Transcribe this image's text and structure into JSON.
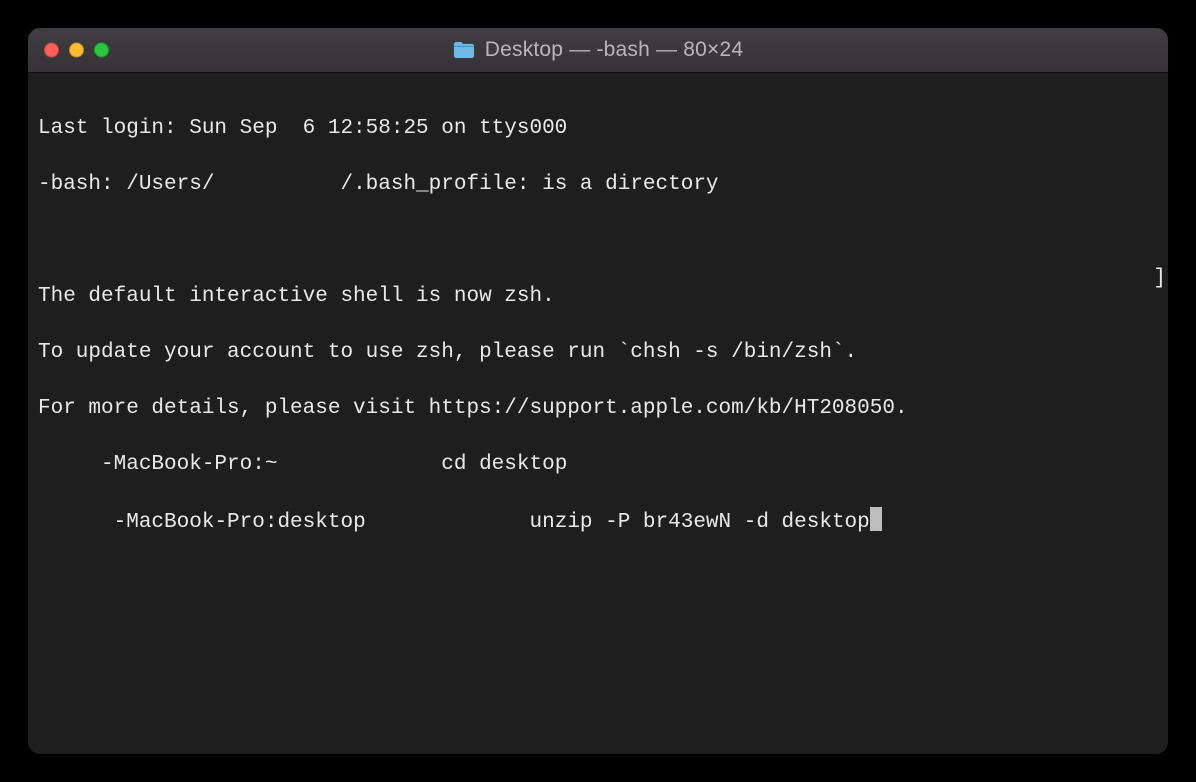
{
  "window": {
    "title": "Desktop — -bash — 80×24"
  },
  "terminal": {
    "line1": "Last login: Sun Sep  6 12:58:25 on ttys000",
    "line2a": "-bash: /Users/",
    "line2blank": "          ",
    "line2b": "/.bash_profile: is a directory",
    "line3": "",
    "line4": "The default interactive shell is now zsh.",
    "line5": "To update your account to use zsh, please run `chsh -s /bin/zsh`.",
    "line6": "For more details, please visit https://support.apple.com/kb/HT208050.",
    "line7blank1": "     ",
    "line7a": "-MacBook-Pro:~ ",
    "line7blank2": "           ",
    "line7b": " cd desktop",
    "line8blank1": "      ",
    "line8a": "-MacBook-Pro:desktop ",
    "line8blank2": "           ",
    "line8b": " unzip -P br43ewN -d desktop",
    "right_bracket": "]"
  }
}
